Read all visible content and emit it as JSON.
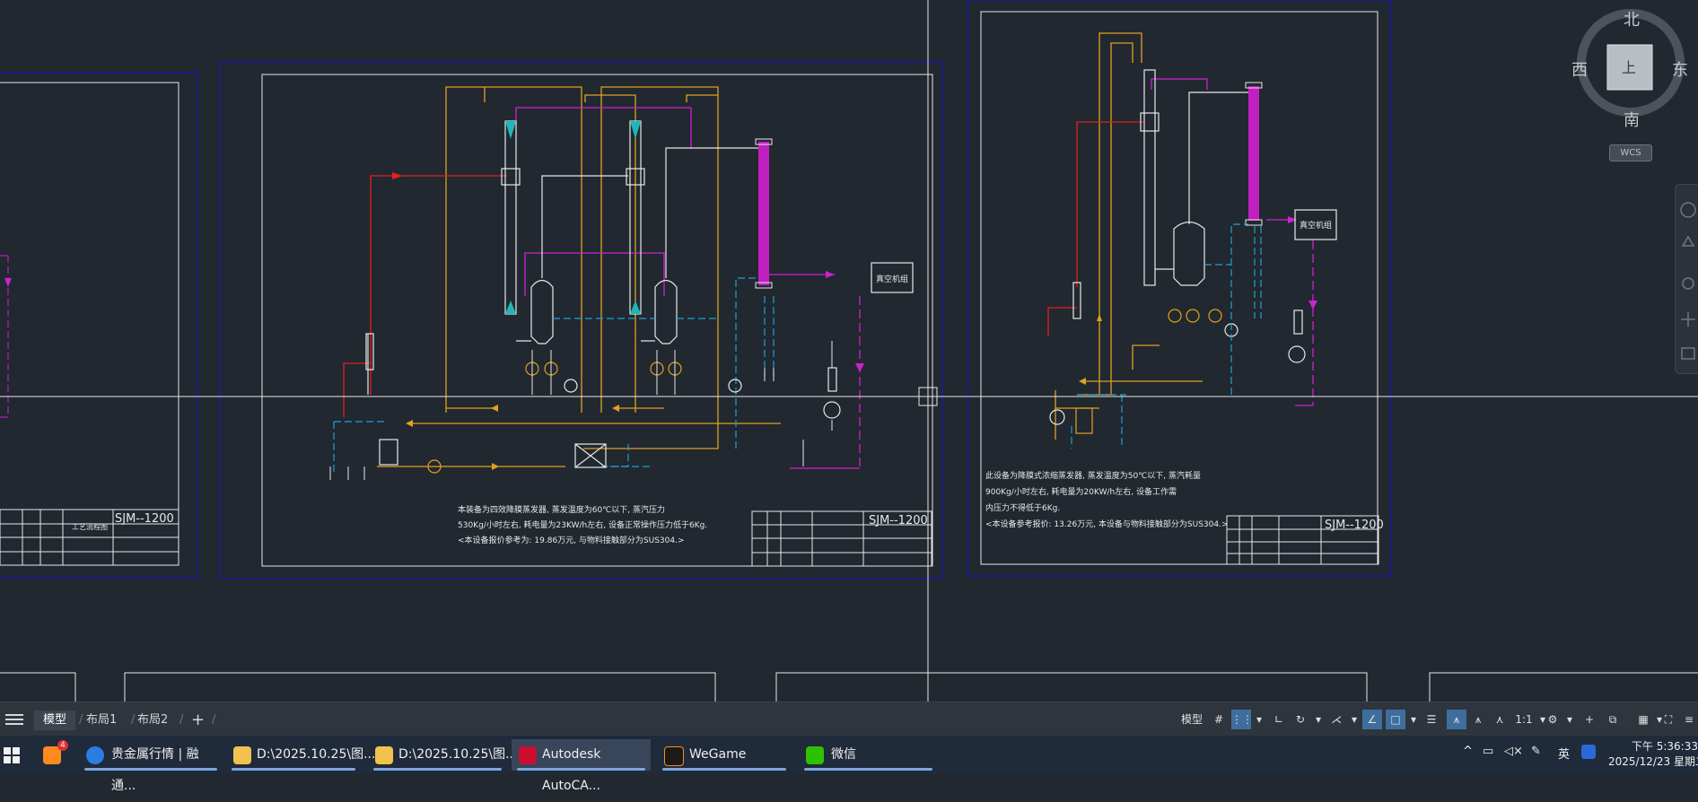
{
  "viewcube": {
    "north": "北",
    "south": "南",
    "east": "东",
    "west": "西",
    "top": "上",
    "wcs": "WCS"
  },
  "drawings": {
    "left_title_block": "SJM--1200",
    "left_title_label": "工艺流程图",
    "center_title_block": "SJM--1200",
    "center_vacuum": "真空机组",
    "center_notes": [
      "本装备为四效降膜蒸发器, 蒸发温度为60℃以下, 蒸汽压力",
      "530Kg/小时左右, 耗电量为23KW/h左右, 设备正常操作压力低于6Kg.",
      "<本设备报价参考为: 19.86万元, 与物料接触部分为SUS304.>"
    ],
    "right_title_block": "SJM--1200",
    "right_vacuum": "真空机组",
    "right_notes": [
      "此设备为降膜式浓缩蒸发器, 蒸发温度为50℃以下, 蒸汽耗量",
      "900Kg/小时左右, 耗电量为20KW/h左右, 设备工作需",
      "内压力不得低于6Kg.",
      "<本设备参考报价: 13.26万元, 本设备与物料接触部分为SUS304.>"
    ]
  },
  "layout_tabs": {
    "model": "模型",
    "layout1": "布局1",
    "layout2": "布局2",
    "add": "+"
  },
  "status_bar": {
    "model": "模型",
    "scale": "1:1"
  },
  "taskbar": {
    "items": [
      {
        "label": "贵金属行情 | 融通...",
        "active": false
      },
      {
        "label": "D:\\2025.10.25\\图...",
        "active": false
      },
      {
        "label": "D:\\2025.10.25\\图...",
        "active": false
      },
      {
        "label": "Autodesk AutoCA...",
        "active": true
      },
      {
        "label": "WeGame",
        "active": false
      },
      {
        "label": "微信",
        "active": false
      }
    ],
    "notification_badge": "4",
    "ime": "英",
    "time": "下午 5:36:33",
    "date": "2025/12/23 星期二"
  },
  "colors": {
    "background": "#212830",
    "frame_blue": "#1a1aa0",
    "white": "#e8e8e8",
    "yellow": "#e0a020",
    "magenta": "#d020d0",
    "red": "#e02020",
    "cyan": "#20a0d0"
  }
}
